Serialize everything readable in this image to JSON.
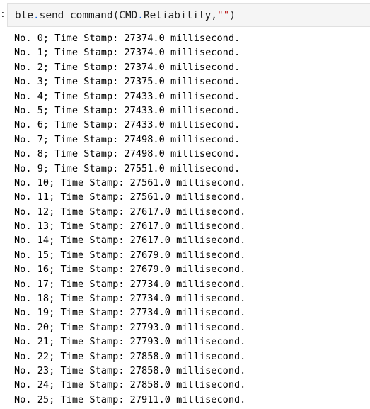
{
  "prompt_marker": ":",
  "input_cell": {
    "tokens": [
      {
        "text": "ble",
        "kind": "var"
      },
      {
        "text": ".",
        "kind": "op"
      },
      {
        "text": "send_command",
        "kind": "fn"
      },
      {
        "text": "(CMD",
        "kind": "var"
      },
      {
        "text": ".",
        "kind": "op"
      },
      {
        "text": "Reliability",
        "kind": "attr"
      },
      {
        "text": ",",
        "kind": "var"
      },
      {
        "text": "\"\"",
        "kind": "str"
      },
      {
        "text": ")",
        "kind": "var"
      }
    ]
  },
  "output": {
    "lines": [
      "No. 0; Time Stamp: 27374.0 millisecond.",
      "No. 1; Time Stamp: 27374.0 millisecond.",
      "No. 2; Time Stamp: 27374.0 millisecond.",
      "No. 3; Time Stamp: 27375.0 millisecond.",
      "No. 4; Time Stamp: 27433.0 millisecond.",
      "No. 5; Time Stamp: 27433.0 millisecond.",
      "No. 6; Time Stamp: 27433.0 millisecond.",
      "No. 7; Time Stamp: 27498.0 millisecond.",
      "No. 8; Time Stamp: 27498.0 millisecond.",
      "No. 9; Time Stamp: 27551.0 millisecond.",
      "No. 10; Time Stamp: 27561.0 millisecond.",
      "No. 11; Time Stamp: 27561.0 millisecond.",
      "No. 12; Time Stamp: 27617.0 millisecond.",
      "No. 13; Time Stamp: 27617.0 millisecond.",
      "No. 14; Time Stamp: 27617.0 millisecond.",
      "No. 15; Time Stamp: 27679.0 millisecond.",
      "No. 16; Time Stamp: 27679.0 millisecond.",
      "No. 17; Time Stamp: 27734.0 millisecond.",
      "No. 18; Time Stamp: 27734.0 millisecond.",
      "No. 19; Time Stamp: 27734.0 millisecond.",
      "No. 20; Time Stamp: 27793.0 millisecond.",
      "No. 21; Time Stamp: 27793.0 millisecond.",
      "No. 22; Time Stamp: 27858.0 millisecond.",
      "No. 23; Time Stamp: 27858.0 millisecond.",
      "No. 24; Time Stamp: 27858.0 millisecond.",
      "No. 25; Time Stamp: 27911.0 millisecond."
    ]
  }
}
